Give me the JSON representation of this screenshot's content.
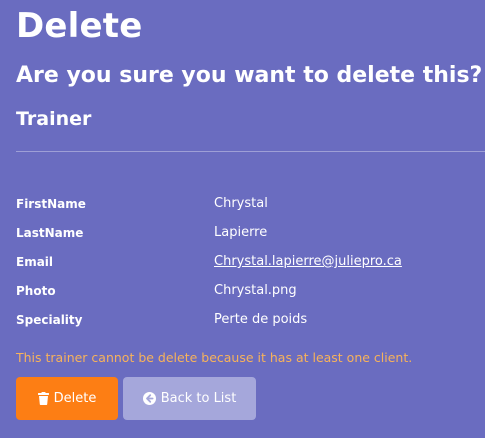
{
  "page": {
    "title": "Delete",
    "confirm_question": "Are you sure you want to delete this?",
    "entity": "Trainer"
  },
  "details": [
    {
      "label": "FirstName",
      "value": "Chrystal"
    },
    {
      "label": "LastName",
      "value": "Lapierre"
    },
    {
      "label": "Email",
      "value": "Chrystal.lapierre@juliepro.ca"
    },
    {
      "label": "Photo",
      "value": "Chrystal.png"
    },
    {
      "label": "Speciality",
      "value": "Perte de poids"
    }
  ],
  "warning": "This trainer cannot be delete because it has at least one client.",
  "actions": {
    "delete_label": "Delete",
    "back_label": "Back to List"
  },
  "colors": {
    "background": "#6a6cc0",
    "warning": "#f7b25b",
    "delete_button": "#fd7e14",
    "back_button": "#a5a7db"
  },
  "icons": {
    "delete": "trash-icon",
    "back": "arrow-circle-left-icon"
  }
}
